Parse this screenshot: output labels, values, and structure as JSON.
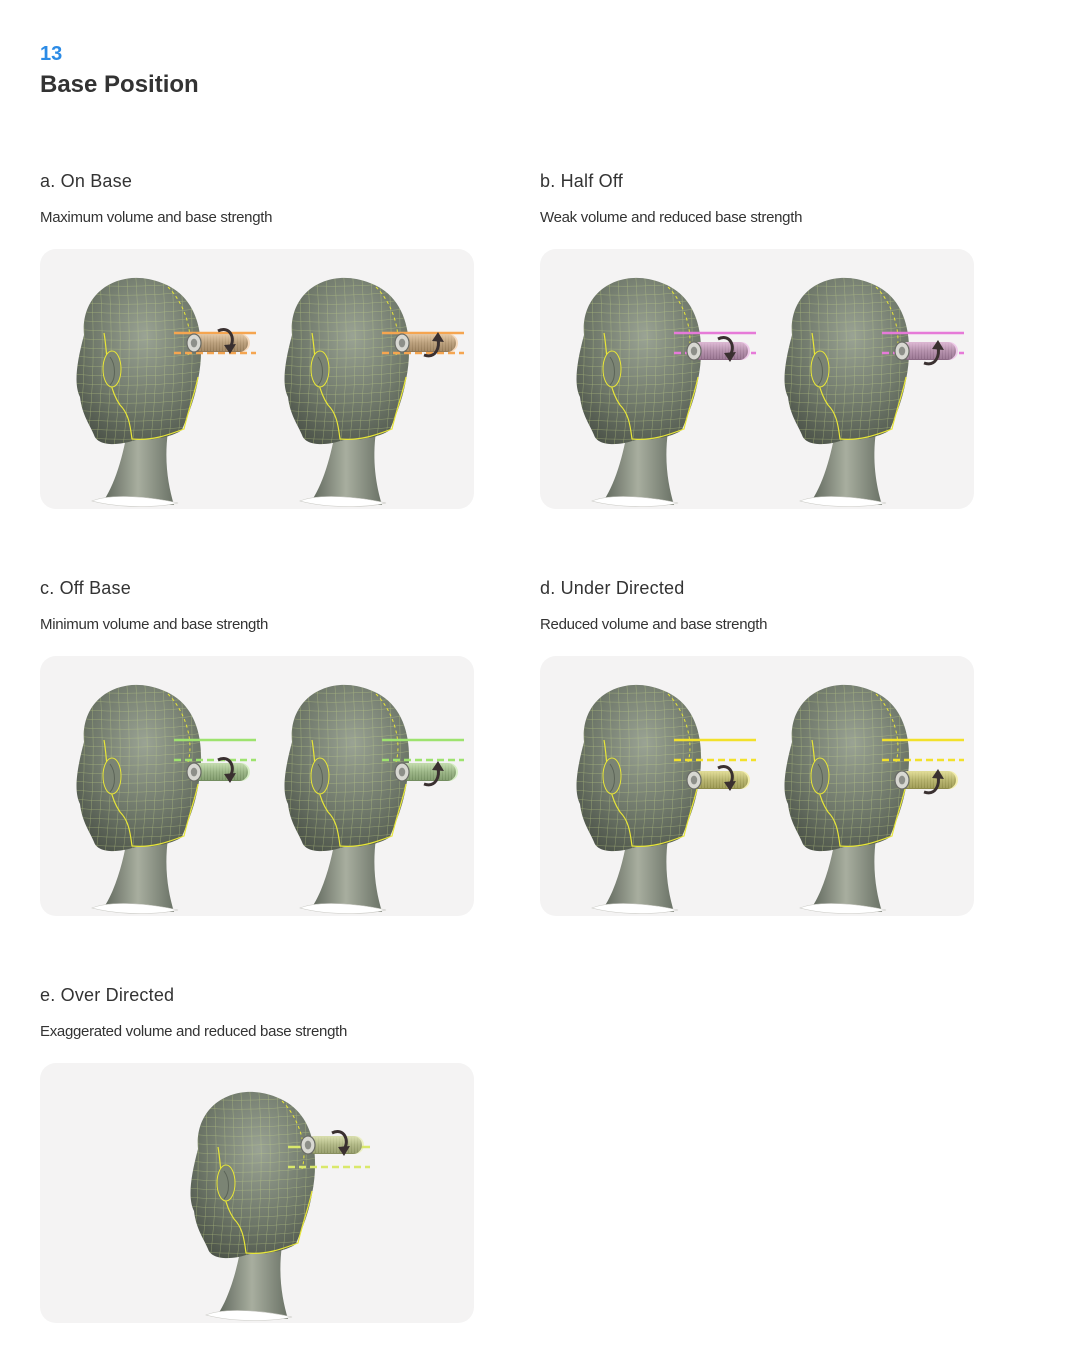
{
  "header": {
    "page_number": "13",
    "title": "Base Position"
  },
  "sections": [
    {
      "id": "a",
      "title": "a. On Base",
      "description": "Maximum volume and base strength",
      "accent": "#f5a550",
      "heads": 2,
      "offsets": [
        [
          0,
          0
        ],
        [
          0,
          0
        ]
      ],
      "curl": [
        "down",
        "up"
      ]
    },
    {
      "id": "b",
      "title": "b. Half Off",
      "description": "Weak volume and reduced base strength",
      "accent": "#e67ad8",
      "heads": 2,
      "offsets": [
        [
          0,
          8
        ],
        [
          0,
          8
        ]
      ],
      "curl": [
        "down",
        "up"
      ]
    },
    {
      "id": "c",
      "title": "c. Off Base",
      "description": "Minimum volume and base strength",
      "accent": "#9ee36e",
      "heads": 2,
      "offsets": [
        [
          0,
          22
        ],
        [
          0,
          22
        ]
      ],
      "curl": [
        "down",
        "up"
      ]
    },
    {
      "id": "d",
      "title": "d. Under Directed",
      "description": "Reduced volume and base strength",
      "accent": "#f2e12a",
      "heads": 2,
      "offsets": [
        [
          0,
          30
        ],
        [
          0,
          30
        ]
      ],
      "curl": [
        "down",
        "up"
      ]
    },
    {
      "id": "e",
      "title": "e. Over Directed",
      "description": "Exaggerated volume and reduced base strength",
      "accent": "#d9e86a",
      "heads": 1,
      "offsets": [
        [
          0,
          -12
        ]
      ],
      "curl": [
        "down"
      ]
    }
  ],
  "colors": {
    "page_number": "#2b8be6",
    "panel_bg": "#f4f3f3",
    "head_fill": "#6d7668",
    "wire": "#c9d98a",
    "hairline": "#e8e637",
    "arrow": "#3a3030"
  }
}
